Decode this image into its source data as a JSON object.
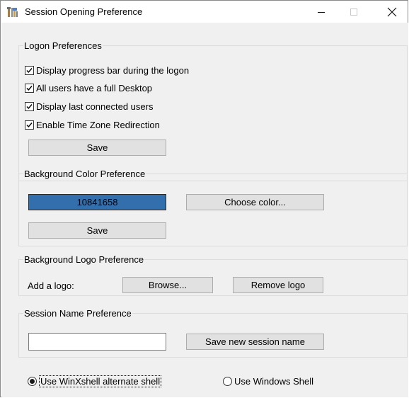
{
  "window": {
    "title": "Session Opening Preference"
  },
  "logon": {
    "legend": "Logon Preferences",
    "options": [
      {
        "label": "Display progress bar during the logon",
        "checked": true
      },
      {
        "label": "All users have a full Desktop",
        "checked": true
      },
      {
        "label": "Display last connected users",
        "checked": true
      },
      {
        "label": "Enable Time Zone Redirection",
        "checked": true
      }
    ],
    "save_label": "Save"
  },
  "bg_color": {
    "legend": "Background Color Preference",
    "value": "10841658",
    "swatch_color": "#336fad",
    "choose_label": "Choose color...",
    "save_label": "Save"
  },
  "bg_logo": {
    "legend": "Background Logo Preference",
    "add_label": "Add a logo:",
    "browse_label": "Browse...",
    "remove_label": "Remove logo"
  },
  "session_name": {
    "legend": "Session Name Preference",
    "input_value": "",
    "save_label": "Save new session name"
  },
  "shell": {
    "options": [
      {
        "label": "Use WinXshell alternate shell",
        "selected": true
      },
      {
        "label": "Use Windows Shell",
        "selected": false
      }
    ]
  }
}
